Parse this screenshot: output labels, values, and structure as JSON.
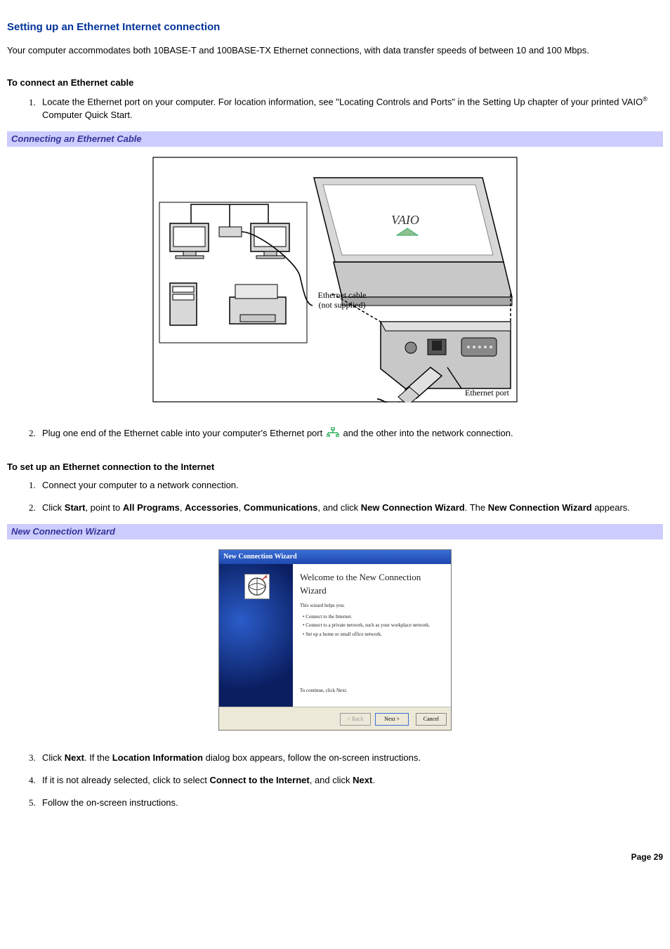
{
  "title": "Setting up an Ethernet Internet connection",
  "intro": "Your computer accommodates both 10BASE-T and 100BASE-TX Ethernet connections, with data transfer speeds of between 10 and 100 Mbps.",
  "section1": {
    "heading": "To connect an Ethernet cable",
    "step1_a": "Locate the Ethernet port on your computer. For location information, see \"Locating Controls and Ports\" in the Setting Up chapter of your printed VAIO",
    "step1_b": " Computer Quick Start.",
    "caption": "Connecting an Ethernet Cable",
    "fig_labels": {
      "cable": "Ethernet cable (not supplied)",
      "port": "Ethernet port",
      "laptop_brand": "VAIO"
    },
    "step2_a": "Plug one end of the Ethernet cable into your computer's Ethernet port ",
    "step2_b": "and the other into the network connection."
  },
  "section2": {
    "heading": "To set up an Ethernet connection to the Internet",
    "step1": "Connect your computer to a network connection.",
    "step2_a": "Click ",
    "step2_b": "Start",
    "step2_c": ", point to ",
    "step2_d": "All Programs",
    "step2_e": ", ",
    "step2_f": "Accessories",
    "step2_g": ", ",
    "step2_h": "Communications",
    "step2_i": ", and click ",
    "step2_j": "New Connection Wizard",
    "step2_k": ". The ",
    "step2_l": "New Connection Wizard",
    "step2_m": " appears.",
    "caption": "New Connection Wizard",
    "wizard": {
      "window_title": "New Connection Wizard",
      "heading": "Welcome to the New Connection Wizard",
      "helps": "This wizard helps you:",
      "b1": "Connect to the Internet.",
      "b2": "Connect to a private network, such as your workplace network.",
      "b3": "Set up a home or small office network.",
      "cont": "To continue, click Next.",
      "back": "< Back",
      "next": "Next >",
      "cancel": "Cancel"
    },
    "step3_a": "Click ",
    "step3_b": "Next",
    "step3_c": ". If the ",
    "step3_d": "Location Information",
    "step3_e": " dialog box appears, follow the on-screen instructions.",
    "step4_a": "If it is not already selected, click to select ",
    "step4_b": "Connect to the Internet",
    "step4_c": ", and click ",
    "step4_d": "Next",
    "step4_e": ".",
    "step5": "Follow the on-screen instructions."
  },
  "page_label": "Page 29"
}
